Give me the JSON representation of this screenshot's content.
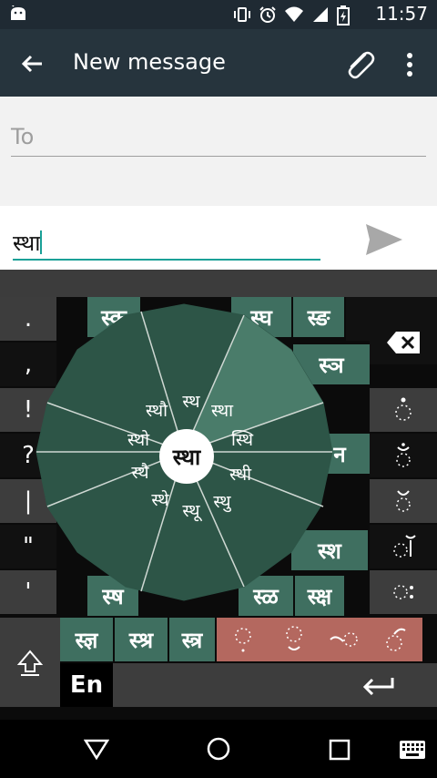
{
  "status_bar": {
    "time": "11:57",
    "icons": [
      "android-icon",
      "vibrate-icon",
      "alarm-icon",
      "wifi-icon",
      "signal-icon",
      "battery-icon"
    ]
  },
  "app_bar": {
    "title": "New message",
    "icons": [
      "back-arrow-icon",
      "attach-icon",
      "more-vert-icon"
    ]
  },
  "compose": {
    "to_placeholder": "To",
    "message_text": "स्था"
  },
  "keyboard": {
    "left_column": [
      ".",
      ",",
      "!",
      "?",
      "|",
      "\"",
      "'"
    ],
    "grid_visible": [
      "स्क",
      "स्घ",
      "स्ङ",
      "स्ञ",
      "न",
      "स्श",
      "स्ष",
      "स्ळ",
      "स्क्ष"
    ],
    "bottom_row": [
      "स्ज्ञ",
      "स्श्र",
      "स्त्र"
    ],
    "radial_center": "स्था",
    "radial_options": [
      "स्थ",
      "स्था",
      "स्थि",
      "स्थी",
      "स्थु",
      "स्थू",
      "स्थे",
      "स्थै",
      "स्थो",
      "स्थौ"
    ],
    "language_key": "En",
    "right_column_icons": [
      "backspace-icon",
      "vowel-sign-ii-icon",
      "candrabindu-icon",
      "candra-icon",
      "virama-icon",
      "visarga-icon"
    ],
    "salmon_keys_icons": [
      "nukta-dots-icon",
      "candra-below-icon",
      "vowel-o-icon",
      "vowel-ii-icon"
    ]
  },
  "nav_bar": {
    "icons": [
      "back-triangle-icon",
      "home-circle-icon",
      "recents-square-icon",
      "keyboard-icon"
    ]
  },
  "colors": {
    "app_bar": "#26343d",
    "accent": "#1aa097",
    "key_green": "#3f6f60",
    "key_salmon": "#b4685f"
  }
}
